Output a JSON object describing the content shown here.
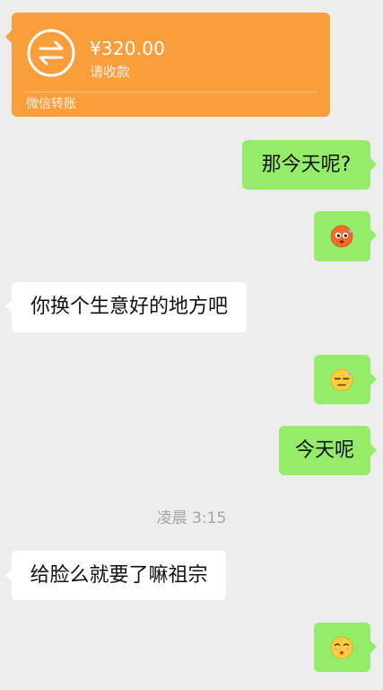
{
  "transfer": {
    "amount": "¥320.00",
    "status": "请收款",
    "footer": "微信转账"
  },
  "messages": [
    {
      "side": "out",
      "type": "text",
      "text": "那今天呢?"
    },
    {
      "side": "out",
      "type": "emoji",
      "icon": "flushed-sweat-emoji"
    },
    {
      "side": "in",
      "type": "text",
      "text": "你换个生意好的地方吧"
    },
    {
      "side": "out",
      "type": "emoji",
      "icon": "unamused-sweat-emoji"
    },
    {
      "side": "out",
      "type": "text",
      "text": "今天呢"
    },
    {
      "side": "in",
      "type": "text",
      "text": "给脸么就要了嘛祖宗"
    },
    {
      "side": "out",
      "type": "emoji",
      "icon": "pouting-face-emoji"
    }
  ],
  "timestamp": "凌晨 3:15",
  "colors": {
    "background": "#ededed",
    "outgoing_bubble": "#95ec69",
    "incoming_bubble": "#ffffff",
    "transfer_card": "#fa9d3b",
    "timestamp_text": "#a3a3a3"
  }
}
